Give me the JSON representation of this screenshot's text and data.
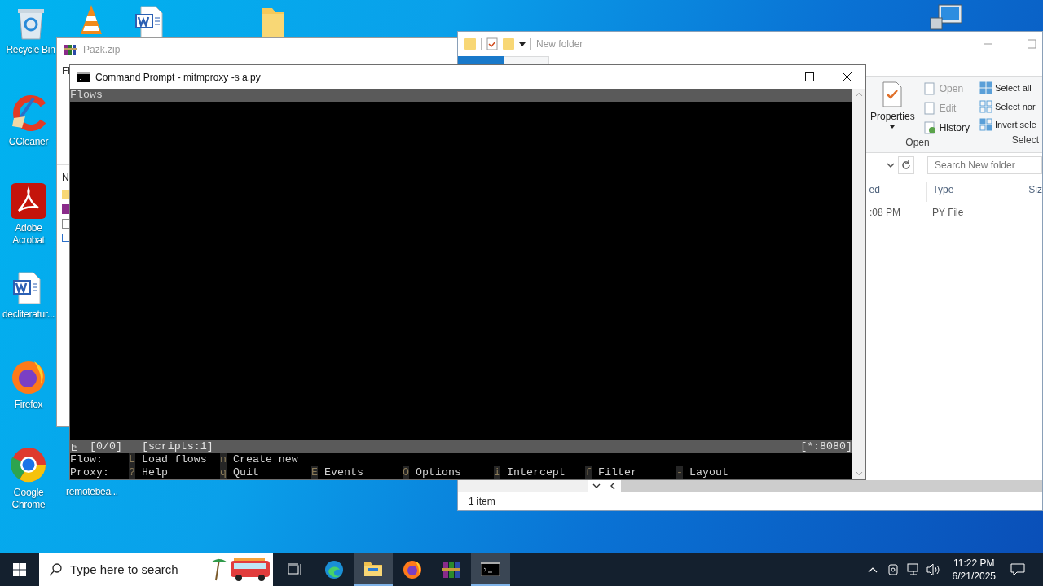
{
  "desktop_icons": [
    {
      "kind": "recycle",
      "label": "Recycle Bin"
    },
    {
      "kind": "cone"
    },
    {
      "kind": "document"
    },
    {
      "kind": "folder"
    },
    {
      "kind": "computer"
    },
    {
      "kind": "cleaner",
      "label": "CCleaner"
    },
    {
      "kind": "pdf",
      "label": "Adobe Acrobat"
    },
    {
      "kind": "document",
      "label": "decliteratur..."
    },
    {
      "kind": "firefox",
      "label": "Firefox"
    },
    {
      "kind": "chrome",
      "label": "Google Chrome"
    },
    {
      "kind": "hidden",
      "label": "remotebea..."
    }
  ],
  "archive_window": {
    "title": "Pazk.zip",
    "menu_fragment": "Fi",
    "header_fragment": "N"
  },
  "explorer_window": {
    "title": "New folder",
    "properties": "Properties",
    "open_items": [
      "Open",
      "Edit",
      "History"
    ],
    "open_group": "Open",
    "select_items": [
      "Select all",
      "Select nor",
      "Invert sele"
    ],
    "select_group": "Select",
    "search_placeholder": "Search New folder",
    "columns": [
      "ed",
      "Type",
      "Siz"
    ],
    "rows": [
      {
        "cells": [
          ":08 PM",
          "PY File"
        ]
      }
    ],
    "status": "1 item"
  },
  "console_window": {
    "title": "Command Prompt - mitmproxy  -s a.py",
    "header": "Flows",
    "status_left": [
      "[0/0]",
      "[scripts:1]"
    ],
    "status_right": "[*:8080]",
    "keybar": [
      {
        "label": "Flow:",
        "items": [
          {
            "key": "L",
            "label": "Load flows"
          },
          {
            "key": "n",
            "label": "Create new"
          }
        ]
      },
      {
        "label": "Proxy:",
        "items": [
          {
            "key": "?",
            "label": "Help"
          },
          {
            "key": "q",
            "label": "Quit"
          },
          {
            "key": "E",
            "label": "Events"
          },
          {
            "key": "O",
            "label": "Options"
          },
          {
            "key": "i",
            "label": "Intercept"
          },
          {
            "key": "f",
            "label": "Filter"
          },
          {
            "key": "-",
            "label": "Layout"
          }
        ]
      }
    ]
  },
  "taskbar": {
    "search_placeholder": "Type here to search",
    "apps": [
      {
        "kind": "taskview",
        "active": false
      },
      {
        "kind": "edge",
        "active": false
      },
      {
        "kind": "explorer",
        "active": true
      },
      {
        "kind": "firefox",
        "active": false
      },
      {
        "kind": "winrar",
        "active": false
      },
      {
        "kind": "terminal",
        "active": true
      }
    ],
    "time": "11:22 PM",
    "date": "6/21/2025"
  }
}
